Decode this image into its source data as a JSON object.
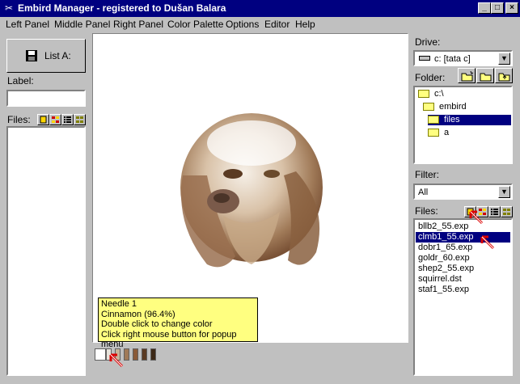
{
  "window": {
    "title": "Embird Manager - registered to Dušan Balara",
    "controls": [
      "_",
      "□",
      "×"
    ]
  },
  "menu": [
    "Left Panel",
    "Middle Panel",
    "Right Panel",
    "Color Palette",
    "Options",
    "Editor",
    "Help"
  ],
  "left_panel": {
    "list_button": "List A:",
    "label_caption": "Label:",
    "label_value": "",
    "files_caption": "Files:"
  },
  "tooltip": {
    "lines": [
      "Needle 1",
      "Cinnamon (96.4%)",
      "Double click to change color",
      "Click right mouse button for popup menu"
    ]
  },
  "palette": {
    "colors": [
      "#ffffff",
      "#e8e4dc",
      "#c8b49a",
      "#a07a58",
      "#8a5a38",
      "#5a3a22",
      "#3c2816"
    ]
  },
  "right_panel": {
    "drive_caption": "Drive:",
    "drive_value": "c: [tata c]",
    "folder_caption": "Folder:",
    "folders": [
      {
        "name": "c:\\",
        "level": 0,
        "selected": false
      },
      {
        "name": "embird",
        "level": 1,
        "selected": false
      },
      {
        "name": "files",
        "level": 2,
        "selected": true
      },
      {
        "name": "a",
        "level": 2,
        "selected": false
      }
    ],
    "filter_caption": "Filter:",
    "filter_value": "All",
    "files_caption": "Files:",
    "files": [
      {
        "name": "bllb2_55.exp",
        "selected": false
      },
      {
        "name": "clmb1_55.exp",
        "selected": true
      },
      {
        "name": "dobr1_65.exp",
        "selected": false
      },
      {
        "name": "goldr_60.exp",
        "selected": false
      },
      {
        "name": "shep2_55.exp",
        "selected": false
      },
      {
        "name": "squirrel.dst",
        "selected": false
      },
      {
        "name": "staf1_55.exp",
        "selected": false
      }
    ]
  }
}
